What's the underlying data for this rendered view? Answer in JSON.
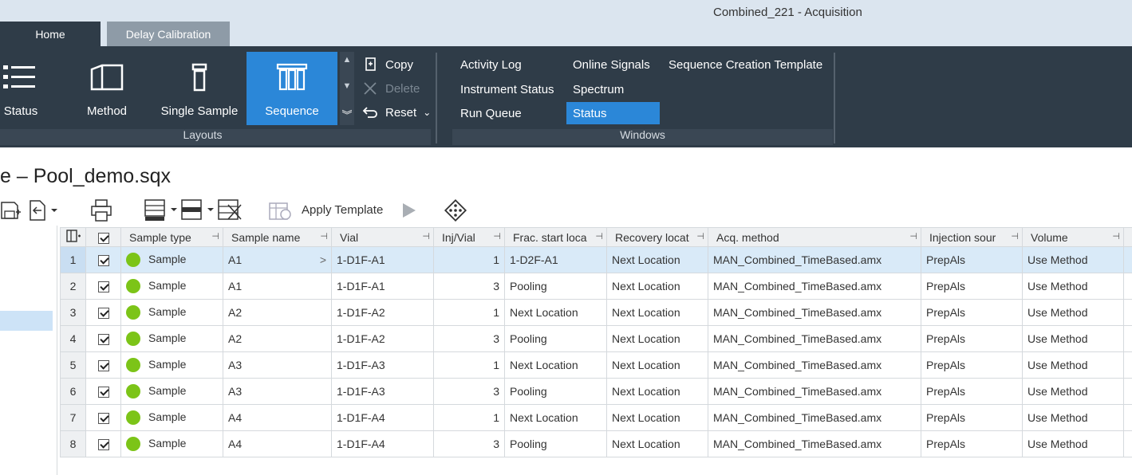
{
  "window": {
    "title": "Combined_221 - Acquisition"
  },
  "tabs": [
    {
      "label": "Home",
      "active": true
    },
    {
      "label": "Delay Calibration",
      "active": false
    }
  ],
  "ribbon": {
    "layouts": {
      "buttons": [
        {
          "label": "Status",
          "icon": "status-list-icon"
        },
        {
          "label": "Method",
          "icon": "method-panel-icon"
        },
        {
          "label": "Single Sample",
          "icon": "single-sample-vial-icon"
        },
        {
          "label": "Sequence",
          "icon": "sequence-vials-icon",
          "active": true
        }
      ],
      "commands": [
        {
          "label": "Copy",
          "icon": "copy-icon",
          "enabled": true
        },
        {
          "label": "Delete",
          "icon": "delete-x-icon",
          "enabled": false
        },
        {
          "label": "Reset",
          "icon": "reset-undo-icon",
          "enabled": true
        }
      ],
      "group_label": "Layouts"
    },
    "windows": {
      "links": [
        {
          "label": "Activity Log"
        },
        {
          "label": "Instrument Status"
        },
        {
          "label": "Run Queue"
        },
        {
          "label": "Online Signals"
        },
        {
          "label": "Spectrum"
        },
        {
          "label": "Status",
          "active": true
        },
        {
          "label": "Sequence Creation Template"
        }
      ],
      "group_label": "Windows"
    }
  },
  "document": {
    "title": "e – Pool_demo.sqx"
  },
  "toolbar": {
    "apply_template_label": "Apply Template"
  },
  "grid": {
    "columns": [
      "Sample type",
      "Sample name",
      "Vial",
      "Inj/Vial",
      "Frac. start loca",
      "Recovery locat",
      "Acq. method",
      "Injection sour",
      "Volume"
    ],
    "rows": [
      {
        "num": "1",
        "type": "Sample",
        "name": "A1",
        "vial": "1-D1F-A1",
        "inj": "1",
        "frac": "1-D2F-A1",
        "recovery": "Next Location",
        "method": "MAN_Combined_TimeBased.amx",
        "source": "PrepAls",
        "volume": "Use Method"
      },
      {
        "num": "2",
        "type": "Sample",
        "name": "A1",
        "vial": "1-D1F-A1",
        "inj": "3",
        "frac": "Pooling",
        "recovery": "Next Location",
        "method": "MAN_Combined_TimeBased.amx",
        "source": "PrepAls",
        "volume": "Use Method"
      },
      {
        "num": "3",
        "type": "Sample",
        "name": "A2",
        "vial": "1-D1F-A2",
        "inj": "1",
        "frac": "Next Location",
        "recovery": "Next Location",
        "method": "MAN_Combined_TimeBased.amx",
        "source": "PrepAls",
        "volume": "Use Method"
      },
      {
        "num": "4",
        "type": "Sample",
        "name": "A2",
        "vial": "1-D1F-A2",
        "inj": "3",
        "frac": "Pooling",
        "recovery": "Next Location",
        "method": "MAN_Combined_TimeBased.amx",
        "source": "PrepAls",
        "volume": "Use Method"
      },
      {
        "num": "5",
        "type": "Sample",
        "name": "A3",
        "vial": "1-D1F-A3",
        "inj": "1",
        "frac": "Next Location",
        "recovery": "Next Location",
        "method": "MAN_Combined_TimeBased.amx",
        "source": "PrepAls",
        "volume": "Use Method"
      },
      {
        "num": "6",
        "type": "Sample",
        "name": "A3",
        "vial": "1-D1F-A3",
        "inj": "3",
        "frac": "Pooling",
        "recovery": "Next Location",
        "method": "MAN_Combined_TimeBased.amx",
        "source": "PrepAls",
        "volume": "Use Method"
      },
      {
        "num": "7",
        "type": "Sample",
        "name": "A4",
        "vial": "1-D1F-A4",
        "inj": "1",
        "frac": "Next Location",
        "recovery": "Next Location",
        "method": "MAN_Combined_TimeBased.amx",
        "source": "PrepAls",
        "volume": "Use Method"
      },
      {
        "num": "8",
        "type": "Sample",
        "name": "A4",
        "vial": "1-D1F-A4",
        "inj": "3",
        "frac": "Pooling",
        "recovery": "Next Location",
        "method": "MAN_Combined_TimeBased.amx",
        "source": "PrepAls",
        "volume": "Use Method"
      }
    ]
  },
  "colors": {
    "ribbon_bg": "#2f3c48",
    "accent": "#2b87d8",
    "status_green": "#7cc418",
    "selected_row": "#d9eaf8"
  }
}
